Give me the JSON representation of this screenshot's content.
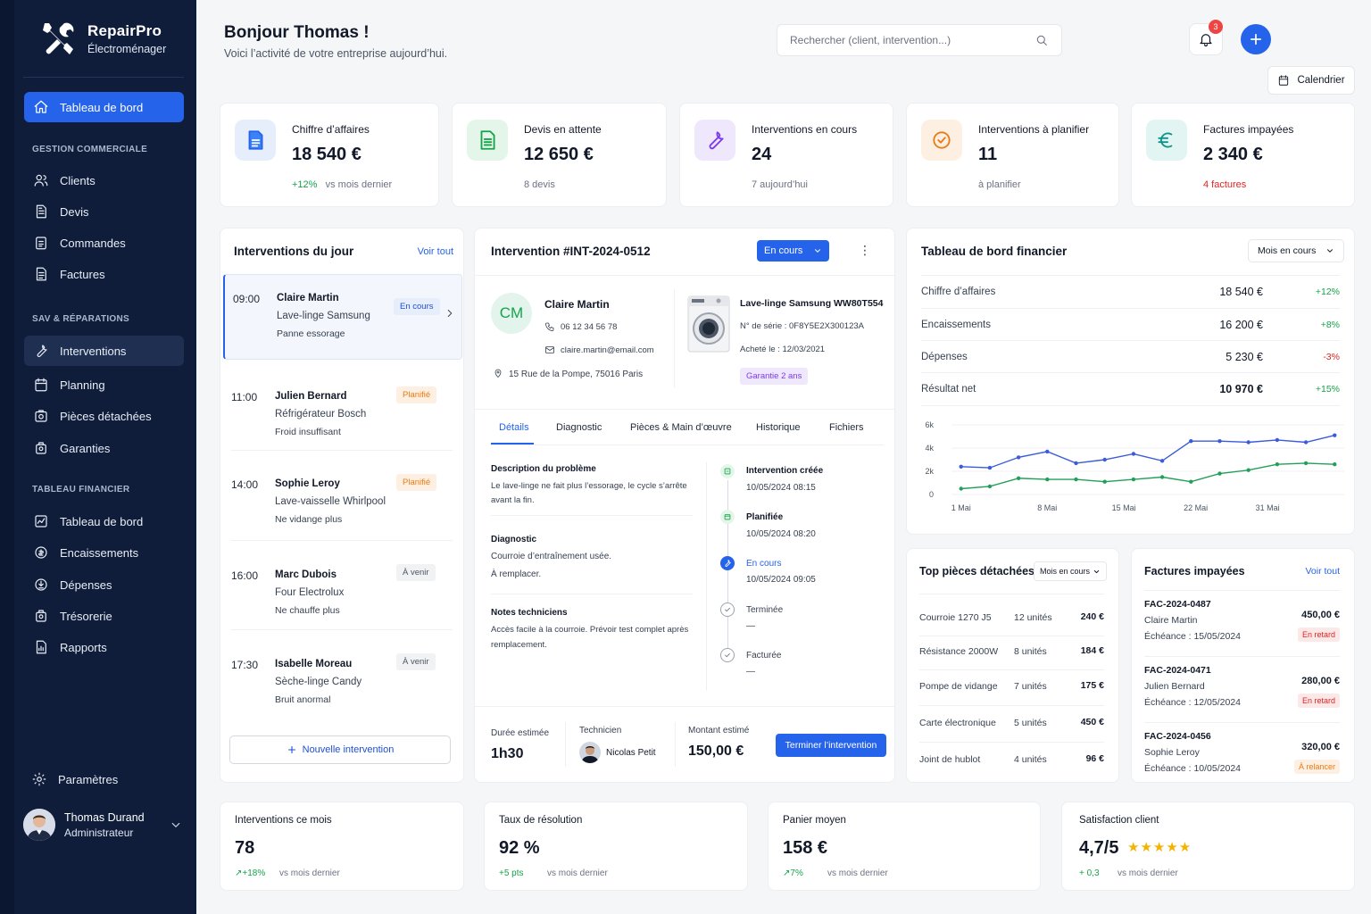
{
  "brand": {
    "name": "RepairPro",
    "subtitle": "Électroménager"
  },
  "nav": {
    "dashboard": "Tableau de bord",
    "sec_commercial": "GESTION COMMERCIALE",
    "clients": "Clients",
    "devis": "Devis",
    "commandes": "Commandes",
    "factures": "Factures",
    "sec_sav": "SAV & RÉPARATIONS",
    "interventions": "Interventions",
    "planning": "Planning",
    "pieces": "Pièces détachées",
    "garanties": "Garanties",
    "sec_fin": "TABLEAU FINANCIER",
    "fin_dashboard": "Tableau de bord",
    "encaissements": "Encaissements",
    "depenses": "Dépenses",
    "tresorerie": "Trésorerie",
    "rapports": "Rapports",
    "settings": "Paramètres"
  },
  "user": {
    "name": "Thomas Durand",
    "role": "Administrateur"
  },
  "header": {
    "greeting": "Bonjour Thomas !",
    "subtitle": "Voici l’activité de votre entreprise aujourd’hui.",
    "search_placeholder": "Rechercher (client, intervention...)",
    "notif_count": "3",
    "calendar": "Calendrier"
  },
  "kpis": [
    {
      "label": "Chiffre d’affaires",
      "value": "18 540 €",
      "delta": "+12%",
      "foot": "vs mois dernier",
      "color": "#2563eb",
      "bg": "#e6eefc",
      "icon": "document-icon"
    },
    {
      "label": "Devis en attente",
      "value": "12 650 €",
      "foot": "8 devis",
      "color": "#16a34a",
      "bg": "#e3f6e9",
      "icon": "quote-icon"
    },
    {
      "label": "Interventions en cours",
      "value": "24",
      "foot": "7 aujourd’hui",
      "color": "#7c3aed",
      "bg": "#efe7fb",
      "icon": "wrench-icon"
    },
    {
      "label": "Interventions à planifier",
      "value": "11",
      "foot": "à planifier",
      "color": "#ea7b13",
      "bg": "#fdf0e2",
      "icon": "check-circle-icon"
    },
    {
      "label": "Factures impayées",
      "value": "2 340 €",
      "foot": "4 factures",
      "color": "#0d9488",
      "bg": "#e2f5f3",
      "icon": "euro-icon"
    }
  ],
  "today": {
    "title": "Interventions du jour",
    "see_all": "Voir tout",
    "new_btn": "Nouvelle intervention",
    "items": [
      {
        "time": "09:00",
        "name": "Claire Martin",
        "device": "Lave-linge Samsung",
        "issue": "Panne essorage",
        "status": "En cours"
      },
      {
        "time": "11:00",
        "name": "Julien Bernard",
        "device": "Réfrigérateur Bosch",
        "issue": "Froid insuffisant",
        "status": "Planifié"
      },
      {
        "time": "14:00",
        "name": "Sophie Leroy",
        "device": "Lave-vaisselle Whirlpool",
        "issue": "Ne vidange plus",
        "status": "Planifié"
      },
      {
        "time": "16:00",
        "name": "Marc Dubois",
        "device": "Four Electrolux",
        "issue": "Ne chauffe plus",
        "status": "À venir"
      },
      {
        "time": "17:30",
        "name": "Isabelle Moreau",
        "device": "Sèche-linge Candy",
        "issue": "Bruit anormal",
        "status": "À venir"
      }
    ]
  },
  "detail": {
    "title": "Intervention #INT-2024-0512",
    "status": "En cours",
    "client": {
      "initials": "CM",
      "name": "Claire Martin",
      "phone": "06 12 34 56 78",
      "email": "claire.martin@email.com",
      "address": "15 Rue de la Pompe, 75016 Paris"
    },
    "device": {
      "name": "Lave-linge Samsung WW80T554",
      "serial": "N° de série : 0F8Y5E2X300123A",
      "bought": "Acheté le : 12/03/2021",
      "warranty": "Garantie 2 ans"
    },
    "tabs": [
      "Détails",
      "Diagnostic",
      "Pièces & Main d’œuvre",
      "Historique",
      "Fichiers"
    ],
    "problem_label": "Description du problème",
    "problem": "Le lave-linge ne fait plus l’essorage, le cycle s’arrête avant la fin.",
    "diag_label": "Diagnostic",
    "diag1": "Courroie d’entraînement usée.",
    "diag2": "À remplacer.",
    "notes_label": "Notes techniciens",
    "notes": "Accès facile à la courroie. Prévoir test complet après remplacement.",
    "timeline": [
      {
        "label": "Intervention créée",
        "date": "10/05/2024 08:15"
      },
      {
        "label": "Planifiée",
        "date": "10/05/2024 08:20"
      },
      {
        "label": "En cours",
        "date": "10/05/2024 09:05"
      },
      {
        "label": "Terminée",
        "date": "—"
      },
      {
        "label": "Facturée",
        "date": "—"
      }
    ],
    "duration_label": "Durée estimée",
    "duration": "1h30",
    "tech_label": "Technicien",
    "tech": "Nicolas Petit",
    "amount_label": "Montant estimé",
    "amount": "150,00 €",
    "finish_btn": "Terminer l’intervention"
  },
  "finance": {
    "title": "Tableau de bord financier",
    "period": "Mois en cours",
    "rows": [
      {
        "label": "Chiffre d’affaires",
        "value": "18 540 €",
        "delta": "+12%"
      },
      {
        "label": "Encaissements",
        "value": "16 200 €",
        "delta": "+8%"
      },
      {
        "label": "Dépenses",
        "value": "5 230 €",
        "delta": "-3%"
      },
      {
        "label": "Résultat net",
        "value": "10 970 €",
        "delta": "+15%"
      }
    ]
  },
  "chart_data": {
    "type": "line",
    "x": [
      1,
      4,
      7,
      10,
      13,
      16,
      19,
      22,
      25,
      28,
      31,
      34,
      37,
      40
    ],
    "xticks": [
      {
        "x": 1,
        "label": "1 Mai"
      },
      {
        "x": 10,
        "label": "8 Mai"
      },
      {
        "x": 18,
        "label": "15 Mai"
      },
      {
        "x": 25.5,
        "label": "22 Mai"
      },
      {
        "x": 33,
        "label": "31 Mai"
      }
    ],
    "yticks": [
      {
        "v": 0,
        "label": "0"
      },
      {
        "v": 2000,
        "label": "2k"
      },
      {
        "v": 4000,
        "label": "4k"
      },
      {
        "v": 6000,
        "label": "6k"
      }
    ],
    "ylim": [
      0,
      6000
    ],
    "xlim": [
      0,
      41
    ],
    "series": [
      {
        "color": "#3b5bdb",
        "values": [
          2400,
          2300,
          3200,
          3700,
          2700,
          3000,
          3500,
          2900,
          4600,
          4600,
          4500,
          4700,
          4500,
          5100
        ]
      },
      {
        "color": "#22a05a",
        "values": [
          500,
          700,
          1400,
          1300,
          1300,
          1100,
          1300,
          1500,
          1100,
          1800,
          2100,
          2600,
          2700,
          2600
        ]
      }
    ]
  },
  "parts": {
    "title": "Top pièces détachées",
    "period": "Mois en cours",
    "rows": [
      {
        "name": "Courroie 1270 J5",
        "qty": "12 unités",
        "amount": "240 €"
      },
      {
        "name": "Résistance 2000W",
        "qty": "8 unités",
        "amount": "184 €"
      },
      {
        "name": "Pompe de vidange",
        "qty": "7 unités",
        "amount": "175 €"
      },
      {
        "name": "Carte électronique",
        "qty": "5 unités",
        "amount": "450 €"
      },
      {
        "name": "Joint de hublot",
        "qty": "4 unités",
        "amount": "96 €"
      }
    ]
  },
  "unpaid": {
    "title": "Factures impayées",
    "see_all": "Voir tout",
    "rows": [
      {
        "id": "FAC-2024-0487",
        "name": "Claire Martin",
        "due": "Échéance : 15/05/2024",
        "amount": "450,00 €",
        "status": "En retard"
      },
      {
        "id": "FAC-2024-0471",
        "name": "Julien Bernard",
        "due": "Échéance : 12/05/2024",
        "amount": "280,00 €",
        "status": "En retard"
      },
      {
        "id": "FAC-2024-0456",
        "name": "Sophie Leroy",
        "due": "Échéance : 10/05/2024",
        "amount": "320,00 €",
        "status": "À relancer"
      }
    ]
  },
  "bottom": [
    {
      "label": "Interventions ce mois",
      "value": "78",
      "delta": "↗+18%",
      "foot": "vs mois dernier"
    },
    {
      "label": "Taux de résolution",
      "value": "92 %",
      "delta": "+5 pts",
      "foot": "vs mois dernier"
    },
    {
      "label": "Panier moyen",
      "value": "158 €",
      "delta": "↗7%",
      "foot": "vs mois dernier"
    },
    {
      "label": "Satisfaction client",
      "value": "4,7/5",
      "delta": "+ 0,3",
      "foot": "vs mois dernier",
      "stars": "★★★★★"
    }
  ]
}
